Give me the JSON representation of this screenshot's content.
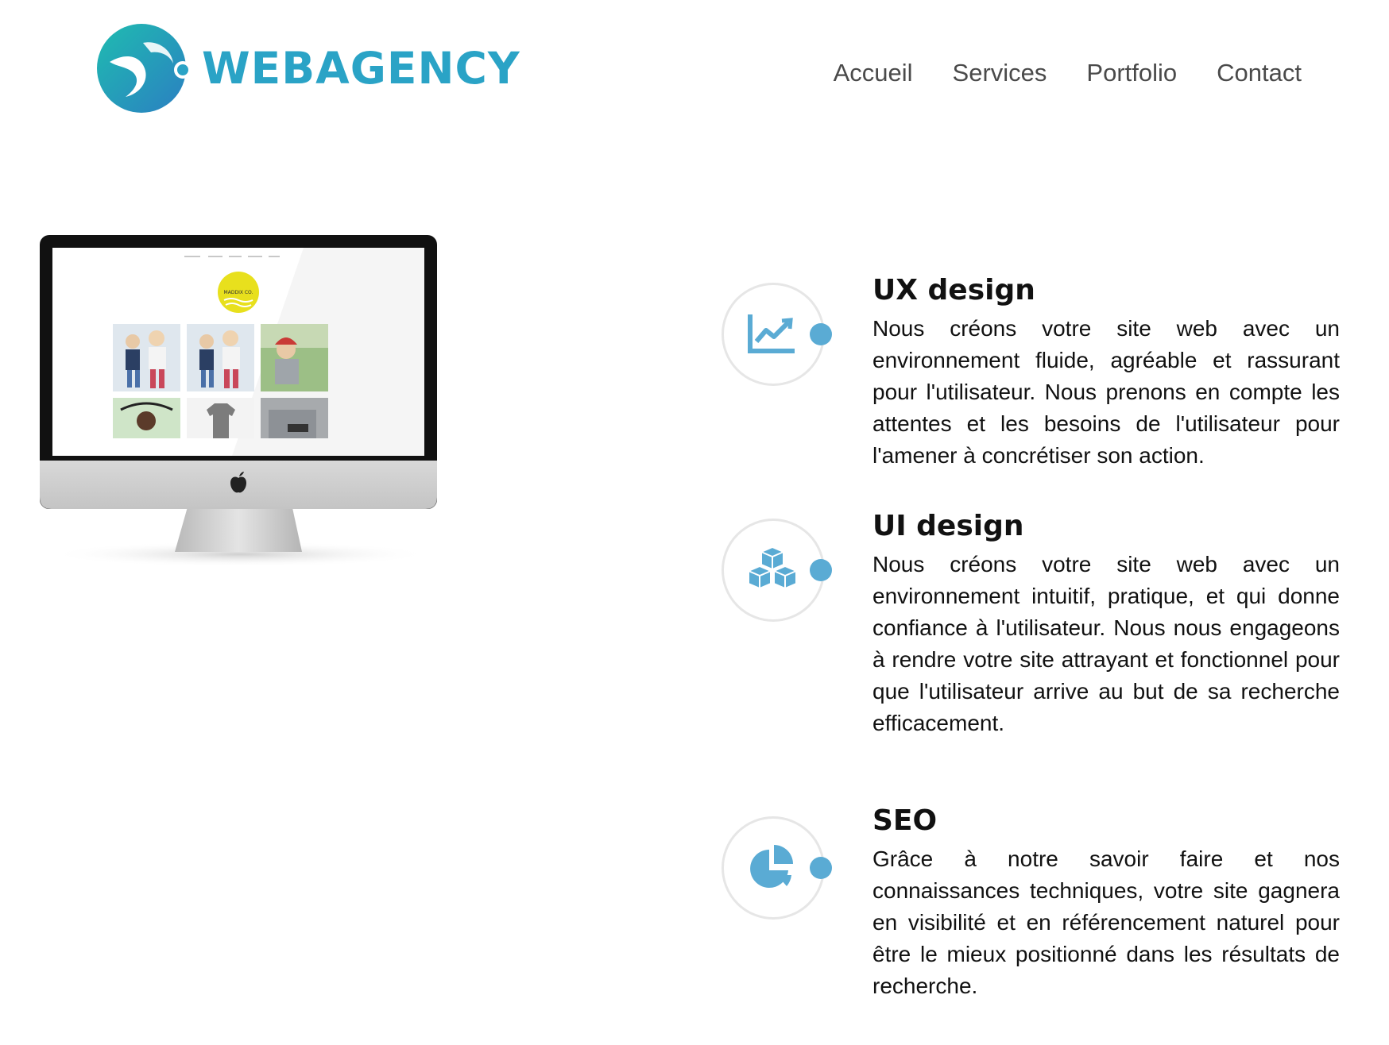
{
  "brand": {
    "name": "WEBAGENCY",
    "color": "#2aa3c6"
  },
  "nav": {
    "items": [
      {
        "label": "Accueil"
      },
      {
        "label": "Services"
      },
      {
        "label": "Portfolio"
      },
      {
        "label": "Contact"
      }
    ]
  },
  "hero_monitor": {
    "screen_logo_text": "MADDIX CO."
  },
  "features": [
    {
      "icon": "chart-line-icon",
      "title": "UX design",
      "text": "Nous créons votre site web avec un environnement fluide, agréable et rassurant pour l'utilisateur. Nous prenons en compte les attentes et les besoins de l'utilisateur pour l'amener à concrétiser son action."
    },
    {
      "icon": "cubes-icon",
      "title": "UI design",
      "text": "Nous créons votre site web avec un environnement intuitif, pratique, et qui donne confiance à l'utilisateur. Nous nous engageons à rendre votre site attrayant et fonctionnel pour que l'utilisateur arrive au but de sa recherche efficacement."
    },
    {
      "icon": "pie-chart-icon",
      "title": "SEO",
      "text": "Grâce à notre savoir faire et nos connaissances techniques, votre site gagnera en visibilité et en référencement naturel pour être le mieux positionné dans les résultats de recherche."
    }
  ],
  "colors": {
    "accent": "#5aabd4",
    "ring": "#e6e6e6",
    "nav_text": "#4a4a4a"
  }
}
